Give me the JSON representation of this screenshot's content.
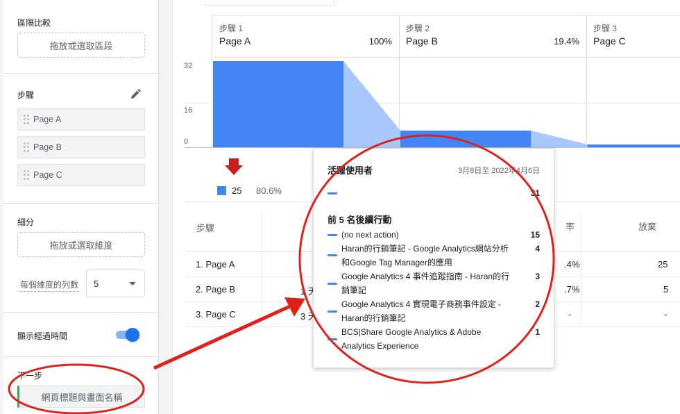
{
  "left_panel": {
    "segment_compare": {
      "title": "區隔比較",
      "drop_label": "拖放或選取區段"
    },
    "steps": {
      "title": "步驟",
      "items": [
        "Page A",
        "Page B",
        "Page C"
      ]
    },
    "breakdown": {
      "title": "細分",
      "drop_label": "拖放或選取維度",
      "rows_label": "每個維度的列數",
      "rows_value": "5"
    },
    "elapsed_time": {
      "label": "顯示經過時間",
      "enabled": true
    },
    "next_action": {
      "title": "下一步",
      "value": "網頁標題與畫面名稱"
    }
  },
  "funnel": {
    "steps": [
      {
        "label": "步驟 1",
        "name": "Page A",
        "pct": "100%"
      },
      {
        "label": "步驟 2",
        "name": "Page B",
        "pct": "19.4%"
      },
      {
        "label": "步驟 3",
        "name": "Page C",
        "pct": ""
      }
    ],
    "y_ticks": [
      "32",
      "16",
      "0"
    ],
    "legend": {
      "value": "25",
      "pct": "80.6%"
    }
  },
  "chart_data": {
    "type": "bar",
    "categories": [
      "Page A",
      "Page B",
      "Page C"
    ],
    "values": [
      31,
      6,
      1
    ],
    "ylim": [
      0,
      32
    ],
    "colors": {
      "bar": "#4285f4",
      "dropoff": "#a8c7fa",
      "arrow": "#c5221f"
    }
  },
  "table": {
    "header_step": "步驟",
    "header_rate_partial": "率",
    "header_abandon": "放棄",
    "rows": [
      {
        "step": "1. Page A",
        "mid": "",
        "rate": ".4%",
        "abandon": "25"
      },
      {
        "step": "2. Page B",
        "mid": "1 天",
        "rate": ".7%",
        "abandon": "5"
      },
      {
        "step": "3. Page C",
        "mid": "3 天",
        "rate": "-",
        "abandon": "-"
      }
    ]
  },
  "tooltip": {
    "title": "活躍使用者",
    "date_range": "3月8日至 2022年4月6日",
    "total": "31",
    "subtitle": "前 5 名後續行動",
    "items": [
      {
        "label": "(no next action)",
        "count": "15"
      },
      {
        "label": "Haran的行銷筆記 - Google Analytics網站分析和Google Tag Manager的應用",
        "count": "4"
      },
      {
        "label": "Google Analytics 4 事件追蹤指南 - Haran的行銷筆記",
        "count": "3"
      },
      {
        "label": "Google Analytics 4 實現電子商務事件設定 - Haran的行銷筆記",
        "count": "2"
      },
      {
        "label": "BCS|Share Google Analytics & Adobe Analytics Experience",
        "count": "1"
      }
    ]
  },
  "annotation_color": "#e0201b"
}
